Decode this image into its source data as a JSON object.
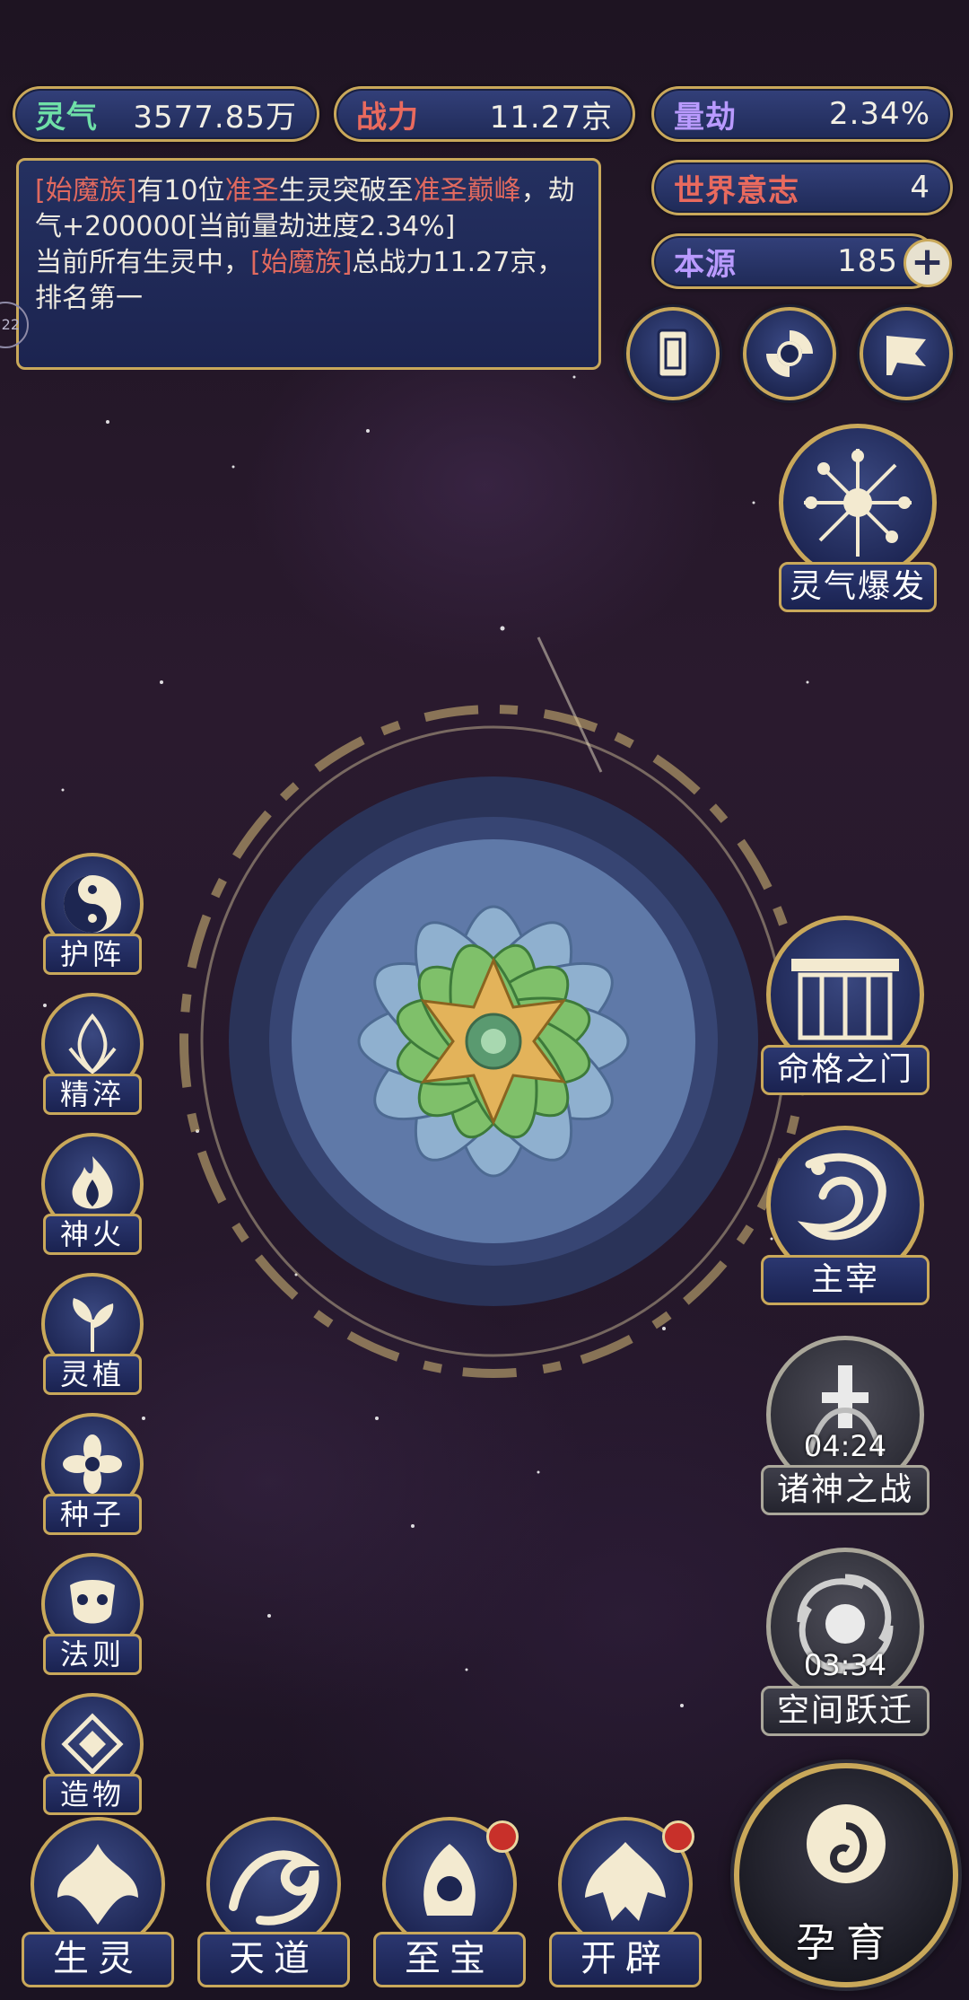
{
  "stats": {
    "lingqi": {
      "label": "灵气",
      "value": "3577.85万",
      "color": "#6fe0a8"
    },
    "zhanli": {
      "label": "战力",
      "value": "11.27京",
      "color": "#e96a5e"
    },
    "liangjie": {
      "label": "量劫",
      "value": "2.34%",
      "color": "#b99aff"
    },
    "world_will": {
      "label": "世界意志",
      "value": "4",
      "color": "#e96a5e"
    },
    "benyuan": {
      "label": "本源",
      "value": "185",
      "color": "#b99aff",
      "plus": "+"
    }
  },
  "log": {
    "line1_tag": "[始魔族]",
    "line1_a": "有10位",
    "line1_rank": "准圣",
    "line1_b": "生灵突破至",
    "line1_rank2": "准圣巅峰",
    "line1_c": "，劫气+200000[当前量劫进度2.34%]",
    "line2_a": "当前所有生灵中，",
    "line2_tag": "[始魔族]",
    "line2_b": "总战力11.27京，排名第一"
  },
  "top_icons": [
    "card-icon",
    "vortex-icon",
    "flag-icon"
  ],
  "burst": {
    "label": "灵气爆发"
  },
  "left_buttons": [
    {
      "label": "护阵",
      "icon": "taiji-icon"
    },
    {
      "label": "精淬",
      "icon": "lotus-flame-icon"
    },
    {
      "label": "神火",
      "icon": "fire-icon"
    },
    {
      "label": "灵植",
      "icon": "plant-icon"
    },
    {
      "label": "种子",
      "icon": "flower-icon"
    },
    {
      "label": "法则",
      "icon": "mask-icon"
    },
    {
      "label": "造物",
      "icon": "diamond-icon"
    }
  ],
  "right_buttons": [
    {
      "label": "命格之门",
      "icon": "gate-icon",
      "timer": ""
    },
    {
      "label": "主宰",
      "icon": "dragon-icon",
      "timer": ""
    },
    {
      "label": "诸神之战",
      "icon": "sword-icon",
      "timer": "04:24"
    },
    {
      "label": "空间跃迁",
      "icon": "portal-icon",
      "timer": "03:34"
    }
  ],
  "bottom_buttons": [
    {
      "label": "生灵",
      "icon": "phoenix-icon",
      "badge": false
    },
    {
      "label": "天道",
      "icon": "wave-icon",
      "badge": false
    },
    {
      "label": "至宝",
      "icon": "treasure-icon",
      "badge": true
    },
    {
      "label": "开辟",
      "icon": "axe-icon",
      "badge": true
    }
  ],
  "main_action": {
    "label": "孕育",
    "icon": "embryo-icon"
  },
  "side_tab": {
    "label": "22"
  }
}
